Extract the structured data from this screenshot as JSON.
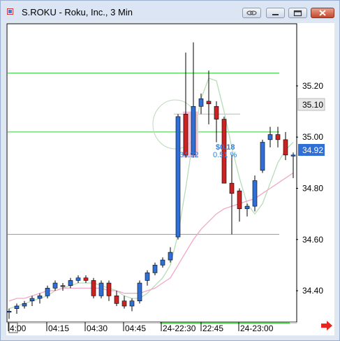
{
  "window": {
    "title": "S.ROKU - Roku, Inc., 3 Min",
    "buttons": [
      "link",
      "minimize",
      "maximize",
      "close"
    ]
  },
  "chart": {
    "price_labels": [
      "35.20",
      "35.10",
      "35.00",
      "34.92",
      "34.80",
      "34.60",
      "34.40"
    ],
    "time_labels": [
      "4:00",
      "04:15",
      "04:30",
      "04:45",
      "24-22:30",
      "22:45",
      "24-23:00"
    ],
    "annotation_price": "34.92",
    "annotation_change": "$0.18",
    "annotation_percent": "0.51 %",
    "last_price_label": "34.92",
    "level_label": "35.10"
  },
  "chart_data": {
    "type": "candlestick",
    "ylim": [
      34.28,
      35.44
    ],
    "y_ticks": [
      35.2,
      35.1,
      35.0,
      34.8,
      34.6,
      34.4
    ],
    "horizontal_lines": [
      {
        "price": 35.25,
        "color": "#33cc33"
      },
      {
        "price": 35.02,
        "color": "#33cc33"
      },
      {
        "price": 34.62,
        "color": "#999999"
      },
      {
        "price": 35.09,
        "color": "#bbbbbb"
      }
    ],
    "colors": {
      "up": "#2f6fd6",
      "down": "#cc2222",
      "ma_fast": "#f0a8c8",
      "ma_slow": "#b8dcb8",
      "green": "#33cc33"
    },
    "candles": [
      {
        "o": 34.32,
        "h": 34.33,
        "l": 34.29,
        "c": 34.32
      },
      {
        "o": 34.33,
        "h": 34.35,
        "l": 34.31,
        "c": 34.34
      },
      {
        "o": 34.34,
        "h": 34.36,
        "l": 34.33,
        "c": 34.35
      },
      {
        "o": 34.36,
        "h": 34.38,
        "l": 34.34,
        "c": 34.37
      },
      {
        "o": 34.37,
        "h": 34.39,
        "l": 34.35,
        "c": 34.38
      },
      {
        "o": 34.38,
        "h": 34.42,
        "l": 34.37,
        "c": 34.41
      },
      {
        "o": 34.41,
        "h": 34.44,
        "l": 34.4,
        "c": 34.43
      },
      {
        "o": 34.42,
        "h": 34.43,
        "l": 34.4,
        "c": 34.42
      },
      {
        "o": 34.42,
        "h": 34.45,
        "l": 34.41,
        "c": 34.44
      },
      {
        "o": 34.44,
        "h": 34.46,
        "l": 34.43,
        "c": 34.45
      },
      {
        "o": 34.45,
        "h": 34.46,
        "l": 34.43,
        "c": 34.44
      },
      {
        "o": 34.44,
        "h": 34.45,
        "l": 34.37,
        "c": 34.38
      },
      {
        "o": 34.38,
        "h": 34.44,
        "l": 34.37,
        "c": 34.43
      },
      {
        "o": 34.43,
        "h": 34.44,
        "l": 34.36,
        "c": 34.38
      },
      {
        "o": 34.38,
        "h": 34.4,
        "l": 34.34,
        "c": 34.35
      },
      {
        "o": 34.36,
        "h": 34.38,
        "l": 34.33,
        "c": 34.34
      },
      {
        "o": 34.34,
        "h": 34.37,
        "l": 34.32,
        "c": 34.36
      },
      {
        "o": 34.36,
        "h": 34.44,
        "l": 34.35,
        "c": 34.43
      },
      {
        "o": 34.44,
        "h": 34.48,
        "l": 34.42,
        "c": 34.47
      },
      {
        "o": 34.47,
        "h": 34.51,
        "l": 34.46,
        "c": 34.5
      },
      {
        "o": 34.5,
        "h": 34.53,
        "l": 34.49,
        "c": 34.52
      },
      {
        "o": 34.52,
        "h": 34.57,
        "l": 34.51,
        "c": 34.55
      },
      {
        "o": 34.61,
        "h": 35.09,
        "l": 34.6,
        "c": 35.08
      },
      {
        "o": 35.09,
        "h": 35.33,
        "l": 34.92,
        "c": 34.93
      },
      {
        "o": 34.93,
        "h": 35.37,
        "l": 34.92,
        "c": 35.12
      },
      {
        "o": 35.12,
        "h": 35.17,
        "l": 35.09,
        "c": 35.15
      },
      {
        "o": 35.14,
        "h": 35.26,
        "l": 35.05,
        "c": 35.13
      },
      {
        "o": 35.12,
        "h": 35.14,
        "l": 34.98,
        "c": 35.07
      },
      {
        "o": 35.07,
        "h": 35.08,
        "l": 34.82,
        "c": 34.82
      },
      {
        "o": 34.82,
        "h": 34.93,
        "l": 34.62,
        "c": 34.78
      },
      {
        "o": 34.79,
        "h": 34.8,
        "l": 34.67,
        "c": 34.72
      },
      {
        "o": 34.72,
        "h": 34.74,
        "l": 34.69,
        "c": 34.73
      },
      {
        "o": 34.73,
        "h": 34.85,
        "l": 34.71,
        "c": 34.83
      },
      {
        "o": 34.87,
        "h": 34.99,
        "l": 34.86,
        "c": 34.98
      },
      {
        "o": 34.99,
        "h": 35.04,
        "l": 34.96,
        "c": 35.01
      },
      {
        "o": 35.01,
        "h": 35.04,
        "l": 34.96,
        "c": 34.99
      },
      {
        "o": 34.99,
        "h": 35.02,
        "l": 34.91,
        "c": 34.93
      },
      {
        "o": 34.93,
        "h": 34.94,
        "l": 34.84,
        "c": 34.93
      }
    ],
    "ma_fast": [
      34.36,
      34.37,
      34.37,
      34.38,
      34.39,
      34.4,
      34.4,
      34.41,
      34.41,
      34.41,
      34.41,
      34.41,
      34.41,
      34.4,
      34.4,
      34.39,
      34.39,
      34.39,
      34.4,
      34.41,
      34.43,
      34.45,
      34.5,
      34.55,
      34.6,
      34.64,
      34.67,
      34.7,
      34.72,
      34.73,
      34.74,
      34.75,
      34.76,
      34.78,
      34.8,
      34.82,
      34.84,
      34.86
    ],
    "ma_slow": [
      34.33,
      34.34,
      34.35,
      34.36,
      34.37,
      34.38,
      34.4,
      34.41,
      34.42,
      34.43,
      34.43,
      34.43,
      34.42,
      34.41,
      34.4,
      34.38,
      34.37,
      34.37,
      34.39,
      34.42,
      34.45,
      34.5,
      34.62,
      34.8,
      35.0,
      35.15,
      35.23,
      35.22,
      35.1,
      34.96,
      34.84,
      34.74,
      34.7,
      34.74,
      34.82,
      34.9,
      34.95,
      34.98
    ]
  }
}
